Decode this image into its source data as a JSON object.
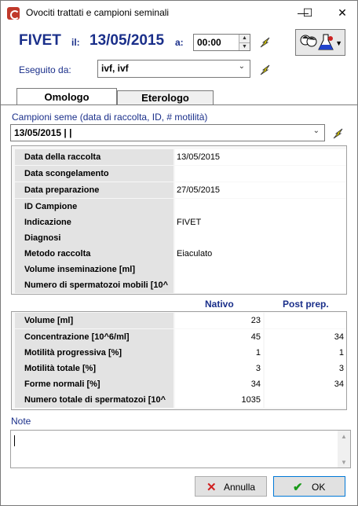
{
  "window": {
    "title": "Ovociti trattati e campioni seminali",
    "minimize": "—",
    "maximize": "☐",
    "close": "✕"
  },
  "header": {
    "procedure": "FIVET",
    "il_label": "il:",
    "date": "13/05/2015",
    "a_label": "a:",
    "time": "00:00",
    "eseguito_label": "Eseguito da:",
    "eseguito_value": "ivf, ivf"
  },
  "tabs": [
    {
      "label": "Omologo"
    },
    {
      "label": "Eterologo"
    }
  ],
  "campioni": {
    "label": "Campioni seme (data di raccolta, ID, # motilità)",
    "value": "13/05/2015 |  |"
  },
  "details": [
    {
      "key": "Data della raccolta",
      "value": "13/05/2015"
    },
    {
      "key": "Data scongelamento",
      "value": ""
    },
    {
      "key": "Data preparazione",
      "value": "27/05/2015"
    },
    {
      "key": "ID Campione",
      "value": ""
    },
    {
      "key": "Indicazione",
      "value": "FIVET"
    },
    {
      "key": "Diagnosi",
      "value": ""
    },
    {
      "key": "Metodo raccolta",
      "value": "Eiaculato"
    },
    {
      "key": "Volume inseminazione [ml]",
      "value": ""
    },
    {
      "key": "Numero di spermatozoi mobili [10^",
      "value": ""
    }
  ],
  "measures": {
    "col_nativo": "Nativo",
    "col_post": "Post prep.",
    "rows": [
      {
        "key": "Volume [ml]",
        "nativo": "23",
        "post": ""
      },
      {
        "key": "Concentrazione [10^6/ml]",
        "nativo": "45",
        "post": "34"
      },
      {
        "key": "Motilità progressiva [%]",
        "nativo": "1",
        "post": "1"
      },
      {
        "key": "Motilità totale [%]",
        "nativo": "3",
        "post": "3"
      },
      {
        "key": "Forme normali [%]",
        "nativo": "34",
        "post": "34"
      },
      {
        "key": "Numero totale di spermatozoi [10^",
        "nativo": "1035",
        "post": ""
      }
    ]
  },
  "note": {
    "label": "Note",
    "value": ""
  },
  "buttons": {
    "cancel": "Annulla",
    "ok": "OK"
  },
  "colors": {
    "accent": "#1a2f8a",
    "bolt": "#e8d800"
  }
}
